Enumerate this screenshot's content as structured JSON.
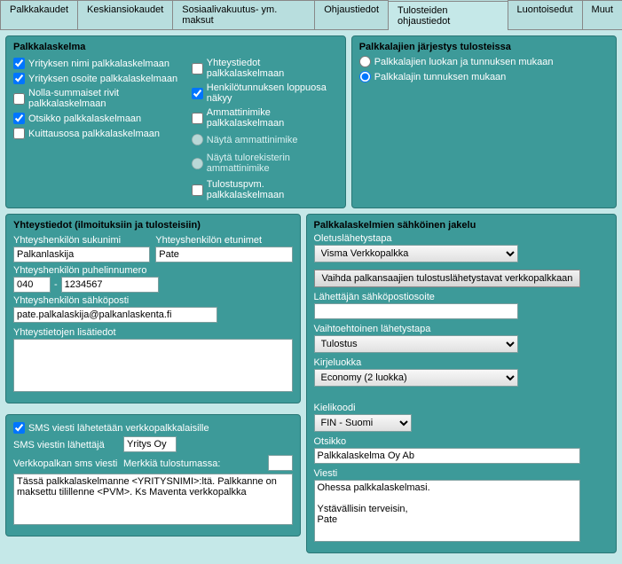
{
  "tabs": {
    "t0": "Palkkakaudet",
    "t1": "Keskiansiokaudet",
    "t2": "Sosiaalivakuutus- ym. maksut",
    "t3": "Ohjaustiedot",
    "t4": "Tulosteiden ohjaustiedot",
    "t5": "Luontoisedut",
    "t6": "Muut"
  },
  "palkkalaskelma": {
    "title": "Palkkalaskelma",
    "c1": "Yrityksen nimi palkkalaskelmaan",
    "c2": "Yrityksen osoite palkkalaskelmaan",
    "c3": "Nolla-summaiset rivit palkkalaskelmaan",
    "c4": "Otsikko palkkalaskelmaan",
    "c5": "Kuittausosa palkkalaskelmaan",
    "c6": "Yhteystiedot palkkalaskelmaan",
    "c7": "Henkilötunnuksen loppuosa näkyy",
    "c8": "Ammattinimike palkkalaskelmaan",
    "c9": "Näytä ammattinimike",
    "c10": "Näytä tulorekisterin ammattinimike",
    "c11": "Tulostuspvm. palkkalaskelmaan"
  },
  "jarjestys": {
    "title": "Palkkalajien järjestys tulosteissa",
    "r1": "Palkkalajien luokan ja tunnuksen mukaan",
    "r2": "Palkkalajin tunnuksen mukaan"
  },
  "yhteys": {
    "title": "Yhteystiedot (ilmoituksiin ja tulosteisiin)",
    "l_suku": "Yhteyshenkilön sukunimi",
    "v_suku": "Palkanlaskija",
    "l_etu": "Yhteyshenkilön etunimet",
    "v_etu": "Pate",
    "l_puh": "Yhteyshenkilön puhelinnumero",
    "v_puh1": "040",
    "dash": "-",
    "v_puh2": "1234567",
    "l_email": "Yhteyshenkilön sähköposti",
    "v_email": "pate.palkalaskija@palkanlaskenta.fi",
    "l_lisa": "Yhteystietojen lisätiedot",
    "v_lisa": ""
  },
  "sms": {
    "c_send": "SMS viesti lähetetään verkkopalkkalaisille",
    "l_sender": "SMS viestin lähettäjä",
    "v_sender": "Yritys Oy",
    "l_merkki": "Merkkiä tulostumassa:",
    "v_merkki": "",
    "l_msg": "Verkkopalkan sms viesti",
    "v_msg": "Tässä palkkalaskelmanne <YRITYSNIMI>:ltä. Palkkanne on maksettu tilillenne <PVM>. Ks Maventa verkkopalkka"
  },
  "sahko": {
    "title": "Palkkalaskelmien sähköinen jakelu",
    "l_oletus": "Oletuslähetystapa",
    "v_oletus": "Visma Verkkopalkka",
    "btn": "Vaihda palkansaajien tulostuslähetystavat verkkopalkkaan",
    "l_lahemail": "Lähettäjän sähköpostiosoite",
    "v_lahemail": "",
    "l_vaihto": "Vaihtoehtoinen lähetystapa",
    "v_vaihto": "Tulostus",
    "l_kirje": "Kirjeluokka",
    "v_kirje": "Economy (2 luokka)",
    "l_kieli": "Kielikoodi",
    "v_kieli": "FIN - Suomi",
    "l_otsikko": "Otsikko",
    "v_otsikko": "Palkkalaskelma Oy Ab",
    "l_viesti": "Viesti",
    "v_viesti": "Ohessa palkkalaskelmasi.\n\nYstävällisin terveisin,\nPate"
  }
}
